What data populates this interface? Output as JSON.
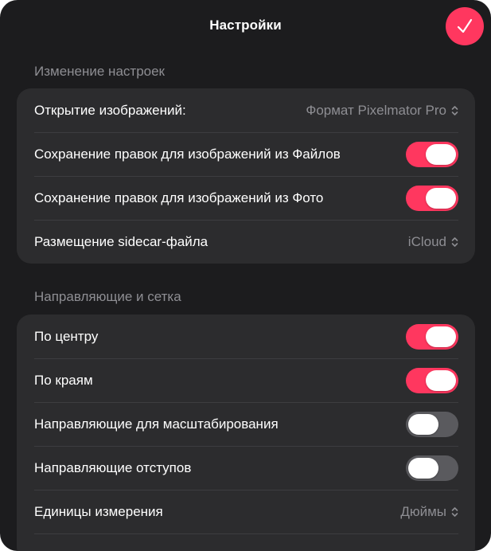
{
  "header": {
    "title": "Настройки",
    "done_icon": "checkmark-icon"
  },
  "colors": {
    "accent": "#ff375f",
    "panel": "#1c1c1e",
    "group": "#2c2c2e",
    "secondary_text": "#8e8e93"
  },
  "sections": [
    {
      "title": "Изменение настроек",
      "rows": [
        {
          "label": "Открытие изображений:",
          "type": "select",
          "value": "Формат Pixelmator Pro"
        },
        {
          "label": "Сохранение правок для изображений из Файлов",
          "type": "toggle",
          "on": true
        },
        {
          "label": "Сохранение правок для изображений из Фото",
          "type": "toggle",
          "on": true
        },
        {
          "label": "Размещение sidecar-файла",
          "type": "select",
          "value": "iCloud"
        }
      ]
    },
    {
      "title": "Направляющие и сетка",
      "rows": [
        {
          "label": "По центру",
          "type": "toggle",
          "on": true
        },
        {
          "label": "По краям",
          "type": "toggle",
          "on": true
        },
        {
          "label": "Направляющие для масштабирования",
          "type": "toggle",
          "on": false
        },
        {
          "label": "Направляющие отступов",
          "type": "toggle",
          "on": false
        },
        {
          "label": "Единицы измерения",
          "type": "select",
          "value": "Дюймы"
        }
      ]
    }
  ]
}
